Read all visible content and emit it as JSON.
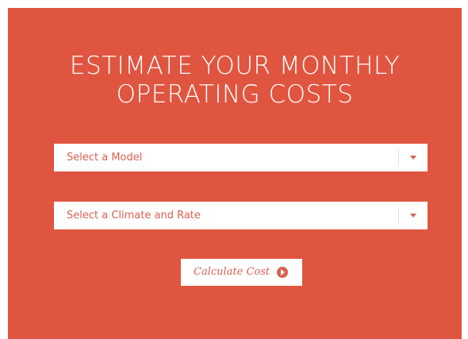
{
  "title": {
    "line1": "ESTIMATE YOUR MONTHLY",
    "line2": "OPERATING COSTS"
  },
  "form": {
    "model_select": {
      "placeholder": "Select a Model",
      "icon": "chevron-down-icon"
    },
    "climate_select": {
      "placeholder": "Select a Climate and Rate",
      "icon": "chevron-down-icon"
    },
    "calculate_button": {
      "label": "Calculate Cost",
      "icon": "play-circle-icon"
    }
  },
  "colors": {
    "panel_background": "#e05540",
    "accent_text": "#d9604f",
    "field_background": "#ffffff"
  }
}
